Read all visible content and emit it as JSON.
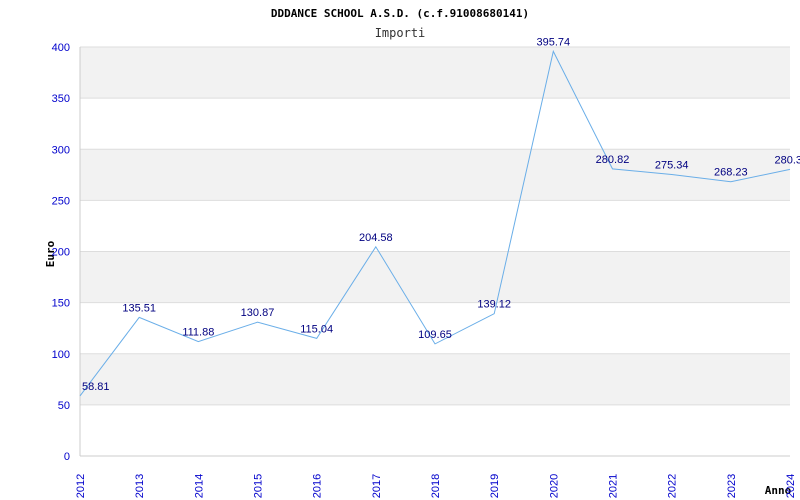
{
  "chart_data": {
    "type": "line",
    "title": "DDDANCE SCHOOL A.S.D. (c.f.91008680141)",
    "subtitle": "Importi",
    "xlabel": "Anno",
    "ylabel": "Euro",
    "ylim": [
      0,
      400
    ],
    "yticks": [
      "0",
      "50",
      "100",
      "150",
      "200",
      "250",
      "300",
      "350",
      "400"
    ],
    "categories": [
      "2012",
      "2013",
      "2014",
      "2015",
      "2016",
      "2017",
      "2018",
      "2019",
      "2020",
      "2021",
      "2022",
      "2023",
      "2024"
    ],
    "values": [
      58.81,
      135.51,
      111.88,
      130.87,
      115.04,
      204.58,
      109.65,
      139.12,
      395.74,
      280.82,
      275.34,
      268.23,
      280.3
    ],
    "data_labels": [
      "58.81",
      "135.51",
      "111.88",
      "130.87",
      "115.04",
      "204.58",
      "109.65",
      "139.12",
      "395.74",
      "280.82",
      "275.34",
      "268.23",
      "280.3"
    ],
    "grid": true,
    "colors": {
      "line": "#6aaee8",
      "band": "#f2f2f2",
      "grid": "#dddddd",
      "tick_text": "#0000cc",
      "label_text": "#000080"
    }
  }
}
